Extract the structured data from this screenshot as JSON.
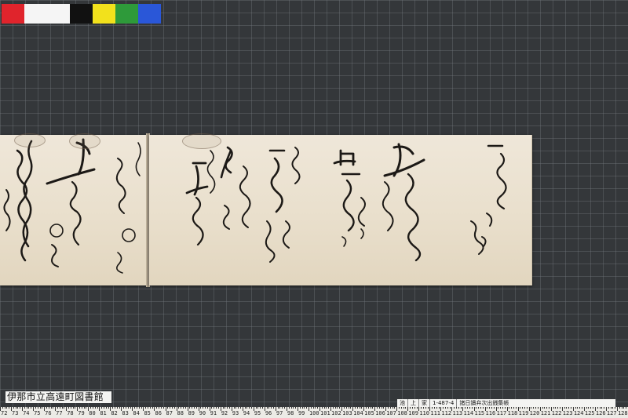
{
  "colors": {
    "mat": "#34373a",
    "paper": "#ece3d2",
    "ink": "#1a1714",
    "color_chart": [
      "#e0242c",
      "#f5f5f5",
      "#111111",
      "#f2e11c",
      "#2e9a3a",
      "#2a57d8"
    ]
  },
  "library_label": "伊那市立高遠町図書館",
  "catalog_label": {
    "field1": "池",
    "field2": "上",
    "field3": "家",
    "field4": "1-487-4",
    "field5": "諸日讀弁次出銭集帳"
  },
  "ruler": {
    "labels_left": [
      "72",
      "73",
      "74",
      "75",
      "76",
      "77",
      "78",
      "79",
      "80",
      "81",
      "82",
      "83",
      "84",
      "85",
      "86",
      "87",
      "88",
      "89",
      "90",
      "91",
      "92",
      "93",
      "94",
      "95",
      "96",
      "97",
      "98",
      "99",
      "100"
    ],
    "labels_right": [
      "101",
      "102",
      "103",
      "104",
      "105",
      "106",
      "107",
      "108",
      "109",
      "110",
      "111",
      "112",
      "113",
      "114",
      "115",
      "116",
      "117",
      "118",
      "119",
      "120",
      "121",
      "122",
      "123",
      "124",
      "125",
      "126",
      "127",
      "128"
    ]
  },
  "document_text": {
    "col1": "一",
    "col2": "百文",
    "col3": "西ノ",
    "col4": "四百"
  }
}
